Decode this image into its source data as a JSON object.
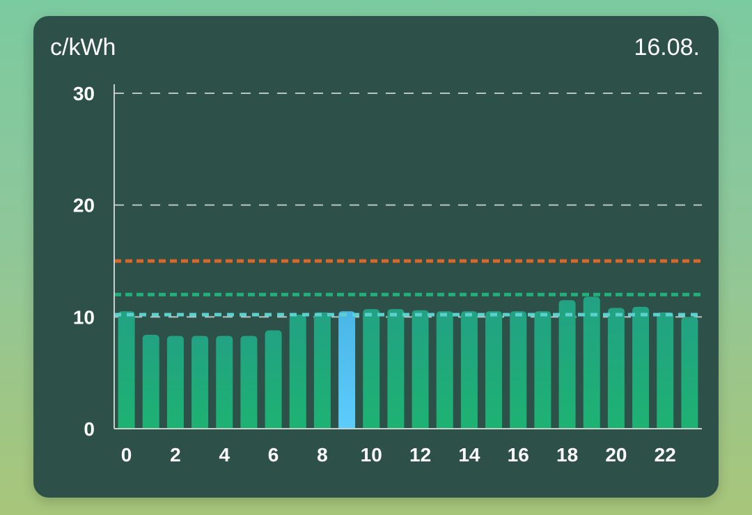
{
  "header": {
    "unit": "c/kWh",
    "date": "16.08."
  },
  "colors": {
    "bar": "#1fa67f",
    "bar_bottom": "#1db070",
    "bar_highlight": "#55c4f0",
    "grid": "#b9c5c1",
    "axis": "#c8d0cd",
    "ref_high": "#d9662b",
    "ref_mid": "#22b07a",
    "ref_avg": "#5cd0cf"
  },
  "chart_data": {
    "type": "bar",
    "xlabel": "",
    "ylabel": "",
    "ylim": [
      0,
      30
    ],
    "yticks": [
      0,
      10,
      20,
      30
    ],
    "x_tick_labels": [
      "0",
      "2",
      "4",
      "6",
      "8",
      "10",
      "12",
      "14",
      "16",
      "18",
      "20",
      "22"
    ],
    "categories": [
      "0",
      "1",
      "2",
      "3",
      "4",
      "5",
      "6",
      "7",
      "8",
      "9",
      "10",
      "11",
      "12",
      "13",
      "14",
      "15",
      "16",
      "17",
      "18",
      "19",
      "20",
      "21",
      "22",
      "23"
    ],
    "values": [
      10.5,
      8.4,
      8.3,
      8.3,
      8.3,
      8.3,
      8.8,
      10.2,
      10.4,
      10.5,
      10.7,
      10.7,
      10.6,
      10.5,
      10.5,
      10.5,
      10.5,
      10.5,
      11.5,
      11.8,
      10.8,
      10.9,
      10.4,
      10.0
    ],
    "highlight_index": 9,
    "reference_lines": [
      {
        "value": 15,
        "color": "#d9662b",
        "style": "dotted"
      },
      {
        "value": 12,
        "color": "#22b07a",
        "style": "dotted"
      },
      {
        "value": 10.2,
        "color": "#5cd0cf",
        "style": "dashed"
      }
    ],
    "grid": true
  }
}
